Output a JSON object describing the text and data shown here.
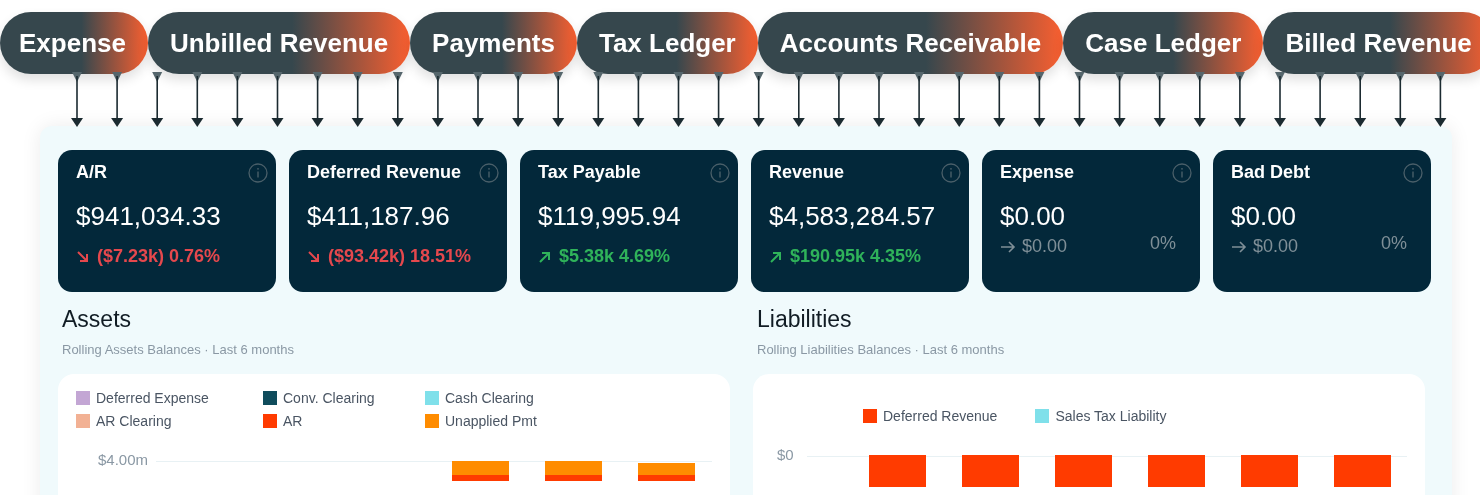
{
  "topics": [
    "Expense",
    "Unbilled Revenue",
    "Payments",
    "Tax Ledger",
    "Accounts Receivable",
    "Case Ledger",
    "Billed Revenue"
  ],
  "cards": [
    {
      "title": "A/R",
      "value": "$941,034.33",
      "kind": "down",
      "change": "($7.23k) 0.76%"
    },
    {
      "title": "Deferred Revenue",
      "value": "$411,187.96",
      "kind": "down",
      "change": "($93.42k) 18.51%"
    },
    {
      "title": "Tax Payable",
      "value": "$119,995.94",
      "kind": "up",
      "change": "$5.38k 4.69%"
    },
    {
      "title": "Revenue",
      "value": "$4,583,284.57",
      "kind": "up",
      "change": "$190.95k 4.35%"
    },
    {
      "title": "Expense",
      "value": "$0.00",
      "kind": "flat",
      "change": "$0.00",
      "percent": "0%"
    },
    {
      "title": "Bad Debt",
      "value": "$0.00",
      "kind": "flat",
      "change": "$0.00",
      "percent": "0%"
    }
  ],
  "assets": {
    "title": "Assets",
    "subtitle": "Rolling Assets Balances · Last 6 months",
    "legend": [
      {
        "label": "Deferred Expense",
        "color": "#c3a6d4"
      },
      {
        "label": "Conv. Clearing",
        "color": "#0f4c5c"
      },
      {
        "label": "Cash Clearing",
        "color": "#7fe0ea"
      },
      {
        "label": "AR Clearing",
        "color": "#f2b194"
      },
      {
        "label": "AR",
        "color": "#ff3b00"
      },
      {
        "label": "Unapplied Pmt",
        "color": "#ff8c00"
      }
    ],
    "tick": "$4.00m"
  },
  "liabilities": {
    "title": "Liabilities",
    "subtitle": "Rolling Liabilities Balances · Last 6 months",
    "legend": [
      {
        "label": "Deferred Revenue",
        "color": "#ff3b00"
      },
      {
        "label": "Sales Tax Liability",
        "color": "#7fe0ea"
      }
    ],
    "tick": "$0"
  }
}
